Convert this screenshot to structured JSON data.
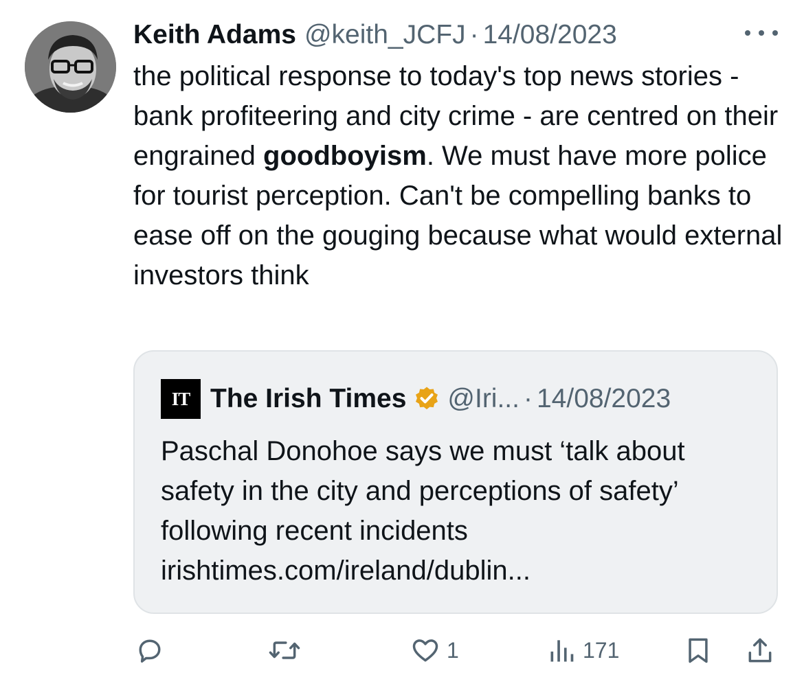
{
  "tweet": {
    "author_name": "Keith Adams",
    "handle": "@keith_JCFJ",
    "separator": "·",
    "date": "14/08/2023",
    "text_before_bold": "the political response to today's top news stories - bank profiteering and city crime - are centred on their engrained ",
    "text_bold": "goodboyism",
    "text_after_bold": ". We must have more police for tourist perception. Can't be compelling banks to ease off on the gouging because what would external investors think"
  },
  "quoted_tweet": {
    "logo_text": "IT",
    "author_name": "The Irish Times",
    "handle": "@Iri...",
    "separator": "·",
    "date": "14/08/2023",
    "text": "Paschal Donohoe says we must ‘talk about safety in the city and perceptions of safety’ following recent incidents irishtimes.com/ireland/dublin..."
  },
  "actions": {
    "reply_count": "",
    "retweet_count": "",
    "like_count": "1",
    "views_count": "171"
  },
  "icons": {
    "more": "more-horizontal-icon",
    "verified": "verified-badge-icon",
    "reply": "reply-icon",
    "retweet": "retweet-icon",
    "like": "heart-icon",
    "views": "views-icon",
    "bookmark": "bookmark-icon",
    "share": "share-icon"
  },
  "colors": {
    "text_primary": "#0f1419",
    "text_secondary": "#536471",
    "verified_gold": "#e8a317",
    "quote_background": "#eff1f3"
  }
}
